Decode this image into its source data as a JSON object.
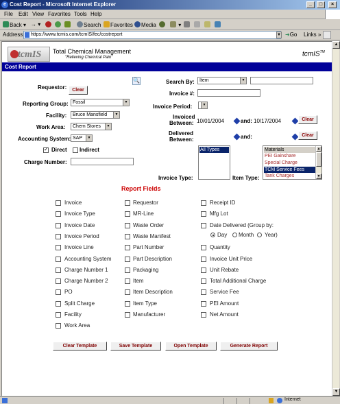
{
  "window": {
    "title": "Cost Report - Microsoft Internet Explorer",
    "buttons": [
      "_",
      "□",
      "×"
    ]
  },
  "menubar": {
    "items": [
      "File",
      "Edit",
      "View",
      "Favorites",
      "Tools",
      "Help"
    ]
  },
  "toolbar": {
    "back": "Back",
    "search": "Search",
    "favorites": "Favorites",
    "media": "Media"
  },
  "addressbar": {
    "label": "Address",
    "url": "https://www.tcmis.com/tcmIS/fec/costreport",
    "go": "Go",
    "links": "Links"
  },
  "header": {
    "logo_text": "tcmIS",
    "company_name": "Total Chemical Management",
    "slogan": "\"Relieving Chemical Pain\"",
    "brand_right": "tcmIS",
    "brand_tm": "TM",
    "page_title": "Cost Report"
  },
  "form": {
    "requestor_label": "Requestor:",
    "requestor_clear": "Clear",
    "reporting_group_label": "Reporting Group:",
    "reporting_group_value": "Fossil",
    "facility_label": "Facility:",
    "facility_value": "Bruce Mansfield",
    "work_area_label": "Work Area:",
    "work_area_value": "Chem Stores",
    "accounting_system_label": "Accounting System:",
    "accounting_system_value": "SAP",
    "direct_label": "Direct",
    "indirect_label": "Indirect",
    "charge_number_label": "Charge Number:",
    "search_by_label": "Search By:",
    "search_by_value": "Item",
    "invoice_no_label": "Invoice #:",
    "invoice_period_label": "Invoice Period:",
    "invoiced_between_label_1": "Invoiced",
    "invoiced_between_label_2": "Between:",
    "invoiced_from": "10/01/2004",
    "invoiced_and": "and:",
    "invoiced_to": "10/17/2004",
    "invoiced_clear": "Clear",
    "delivered_between_label_1": "Delivered",
    "delivered_between_label_2": "Between:",
    "delivered_and": "and:",
    "delivered_clear": "Clear",
    "invoice_type_label": "Invoice Type:",
    "invoice_type_options": [
      "All Types"
    ],
    "item_type_label": "Item Type:",
    "item_type_options": [
      "Materials",
      "PEI Gainshare",
      "Special Charge",
      "TCM Service Fees",
      "Tank Charges"
    ]
  },
  "report_fields": {
    "title": "Report Fields",
    "column1": [
      "Invoice",
      "Invoice Type",
      "Invoice Date",
      "Invoice Period",
      "Invoice Line",
      "Accounting System",
      "Charge Number 1",
      "Charge Number 2",
      "PO",
      "Split Charge",
      "Facility",
      "Work Area"
    ],
    "column2": [
      "Requestor",
      "MR-Line",
      "Waste Order",
      "Waste Manifest",
      "Part Number",
      "Part Description",
      "Packaging",
      "Item",
      "Item Description",
      "Item Type",
      "Manufacturer"
    ],
    "column3": [
      "Receipt ID",
      "Mfg Lot",
      "Date Delivered (Group by:",
      "Quantity",
      "Invoice Unit Price",
      "Unit Rebate",
      "Total Additional Charge",
      "Service Fee",
      "PEI Amount",
      "Net Amount"
    ],
    "group_by_options": [
      "Day",
      "Month",
      "Year)"
    ]
  },
  "actions": {
    "clear_template": "Clear Template",
    "save_template": "Save Template",
    "open_template": "Open Template",
    "generate_report": "Generate Report"
  },
  "statusbar": {
    "zone": "Internet"
  },
  "colors": {
    "header_bar": "#000099",
    "report_fields_title": "#cc0000",
    "button_text": "#800000"
  }
}
